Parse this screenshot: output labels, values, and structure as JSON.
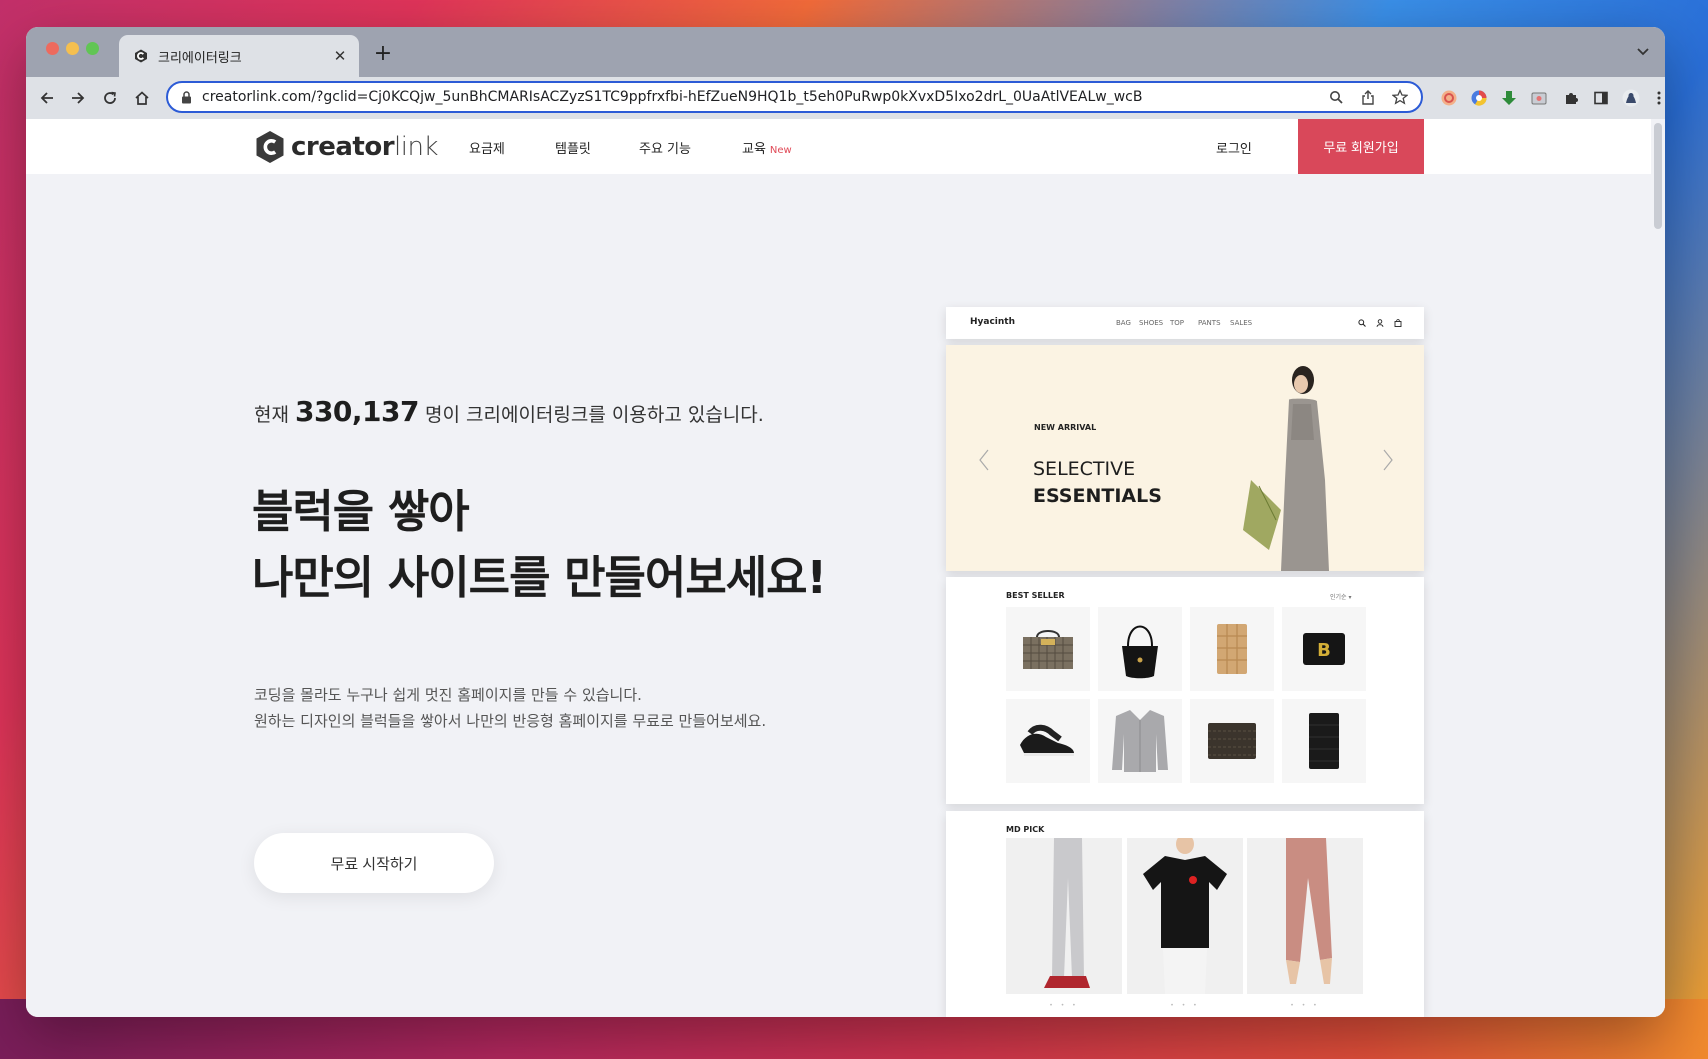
{
  "browser": {
    "tab_title": "크리에이터링크",
    "url": "creatorlink.com/?gclid=Cj0KCQjw_5unBhCMARIsACZyzS1TC9ppfrxfbi-hEfZueN9HQ1b_t5eh0PuRwp0kXvxD5Ixo2drL_0UaAtlVEALw_wcB"
  },
  "site": {
    "logo_bold": "creator",
    "logo_light": "link",
    "nav": {
      "pricing": "요금제",
      "templates": "템플릿",
      "features": "주요 기능",
      "education": "교육",
      "education_badge": "New"
    },
    "login": "로그인",
    "signup": "무료 회원가입"
  },
  "hero": {
    "usage_prefix": "현재",
    "user_count": "330,137",
    "usage_suffix": "명이 크리에이터링크를 이용하고 있습니다.",
    "headline_line1": "블럭을 쌓아",
    "headline_line2": "나만의 사이트를 만들어보세요!",
    "desc_line1": "코딩을 몰라도 누구나 쉽게 멋진 홈페이지를 만들 수 있습니다.",
    "desc_line2": "원하는 디자인의 블럭들을 쌓아서 나만의 반응형 홈페이지를 무료로 만들어보세요.",
    "cta": "무료 시작하기"
  },
  "preview": {
    "brand": "Hyacinth",
    "nav": [
      "BAG",
      "SHOES",
      "TOP",
      "PANTS",
      "SALES"
    ],
    "new_arrival": "NEW ARRIVAL",
    "hero_line1": "SELECTIVE",
    "hero_line2": "ESSENTIALS",
    "best_seller": "BEST SELLER",
    "sort_label": "인기순",
    "md_pick": "MD PICK",
    "carousel_dots": "• • •"
  },
  "colors": {
    "accent": "#d9485a",
    "omnibox_border": "#2c5bd6",
    "page_bg": "#f1f2f6"
  }
}
